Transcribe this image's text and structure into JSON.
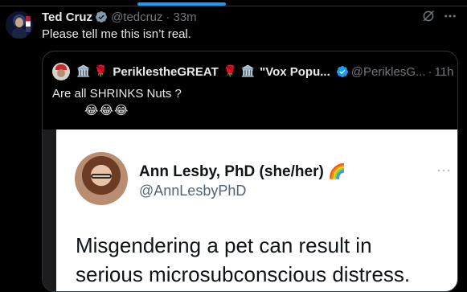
{
  "tweet": {
    "author_name": "Ted Cruz",
    "handle": "@tedcruz",
    "separator": "·",
    "time": "33m",
    "text": "Please tell me this isn’t real."
  },
  "quote": {
    "name_prefix_emojis": "🏛️ 🌹",
    "name": "PeriklestheGREAT",
    "name_suffix_emojis": "🌹 🏛️",
    "second_name": "\"Vox Popu...",
    "handle": "@PeriklesG...",
    "separator": "·",
    "time": "11h",
    "text": "Are all SHRINKS Nuts ?",
    "emoji_line": "😂😂😂"
  },
  "embedded_screenshot": {
    "name": "Ann Lesby, PhD (she/her)",
    "name_emoji": "🌈",
    "handle": "@AnnLesbyPhD",
    "text_line1": "Misgendering a pet can result in",
    "text_line2": "serious microsubconscious distress."
  },
  "colors": {
    "background": "#000000",
    "text_primary": "#e7e9ea",
    "text_secondary": "#71767b",
    "accent": "#1d9bf0",
    "border": "#2f3336"
  },
  "icons": [
    "verified-badge-icon",
    "grok-icon",
    "more-icon"
  ]
}
